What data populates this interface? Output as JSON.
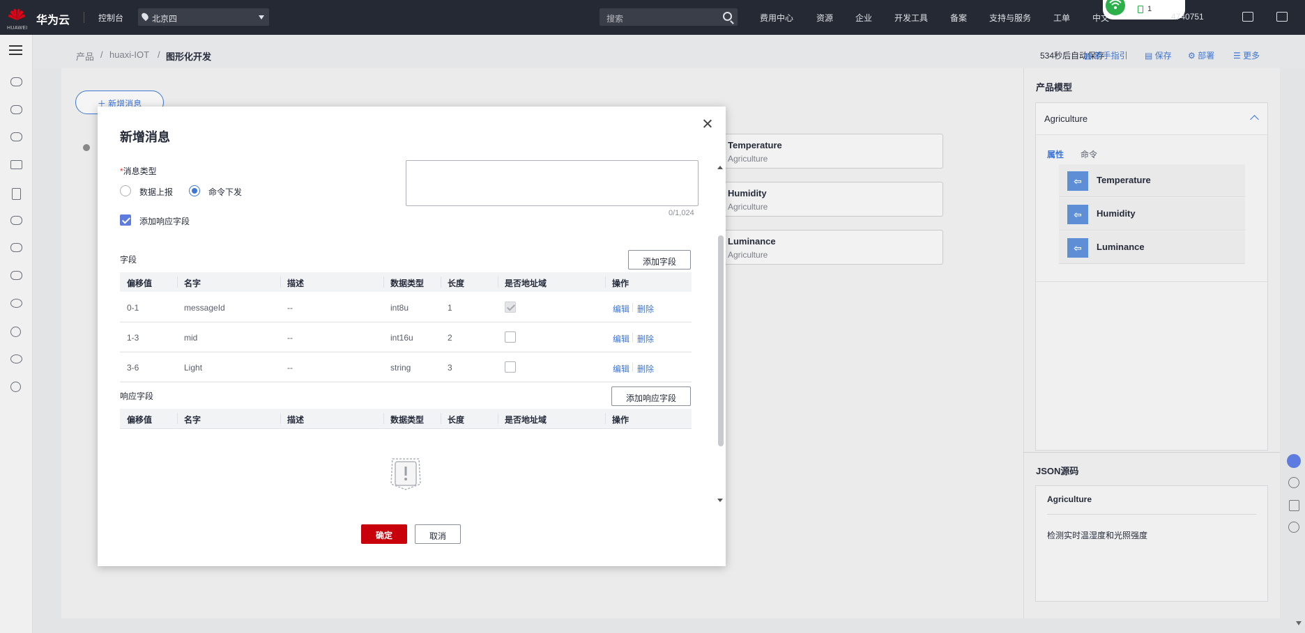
{
  "topbar": {
    "brand": "华为云",
    "logo_text": "HUAWEI",
    "console": "控制台",
    "region": "北京四",
    "search_placeholder": "搜索",
    "nav": [
      "费用中心",
      "资源",
      "企业",
      "开发工具",
      "备案",
      "支持与服务",
      "工单",
      "中文"
    ],
    "wifi_badge": "1",
    "phone_fragment": "4740751"
  },
  "breadcrumb": {
    "items": [
      "产品",
      "huaxi-IOT",
      "图形化开发"
    ],
    "sep": "/",
    "save_status": "534秒后自动保存",
    "actions": [
      "新手指引",
      "保存",
      "部署",
      "更多"
    ]
  },
  "canvas": {
    "add_message": "新增消息",
    "cards": [
      {
        "title": "Temperature",
        "sub": "Agriculture"
      },
      {
        "title": "Humidity",
        "sub": "Agriculture"
      },
      {
        "title": "Luminance",
        "sub": "Agriculture"
      }
    ]
  },
  "right_panel": {
    "model_title": "产品模型",
    "model_name": "Agriculture",
    "tabs": [
      "属性",
      "命令"
    ],
    "properties": [
      "Temperature",
      "Humidity",
      "Luminance"
    ],
    "json_title": "JSON源码",
    "json_name": "Agriculture",
    "json_desc": "检测实时温湿度和光照强度"
  },
  "modal": {
    "title": "新增消息",
    "message_type_label": "消息类型",
    "required_mark": "*",
    "radio_options": [
      "数据上报",
      "命令下发"
    ],
    "radio_selected": "命令下发",
    "add_response_checkbox": "添加响应字段",
    "add_response_checked": true,
    "char_count": "0/1,024",
    "fields_label": "字段",
    "add_field_button": "添加字段",
    "columns": [
      "偏移值",
      "名字",
      "描述",
      "数据类型",
      "长度",
      "是否地址域",
      "操作"
    ],
    "rows": [
      {
        "offset": "0-1",
        "name": "messageId",
        "desc": "--",
        "type": "int8u",
        "length": "1",
        "is_address": true,
        "edit": "编辑",
        "delete": "删除"
      },
      {
        "offset": "1-3",
        "name": "mid",
        "desc": "--",
        "type": "int16u",
        "length": "2",
        "is_address": false,
        "edit": "编辑",
        "delete": "删除"
      },
      {
        "offset": "3-6",
        "name": "Light",
        "desc": "--",
        "type": "string",
        "length": "3",
        "is_address": false,
        "edit": "编辑",
        "delete": "删除"
      }
    ],
    "response_label": "响应字段",
    "add_response_button": "添加响应字段",
    "confirm": "确定",
    "cancel": "取消"
  },
  "colors": {
    "topbar_bg": "#252933",
    "accent": "#3e76d6",
    "confirm_red": "#c7000b"
  }
}
